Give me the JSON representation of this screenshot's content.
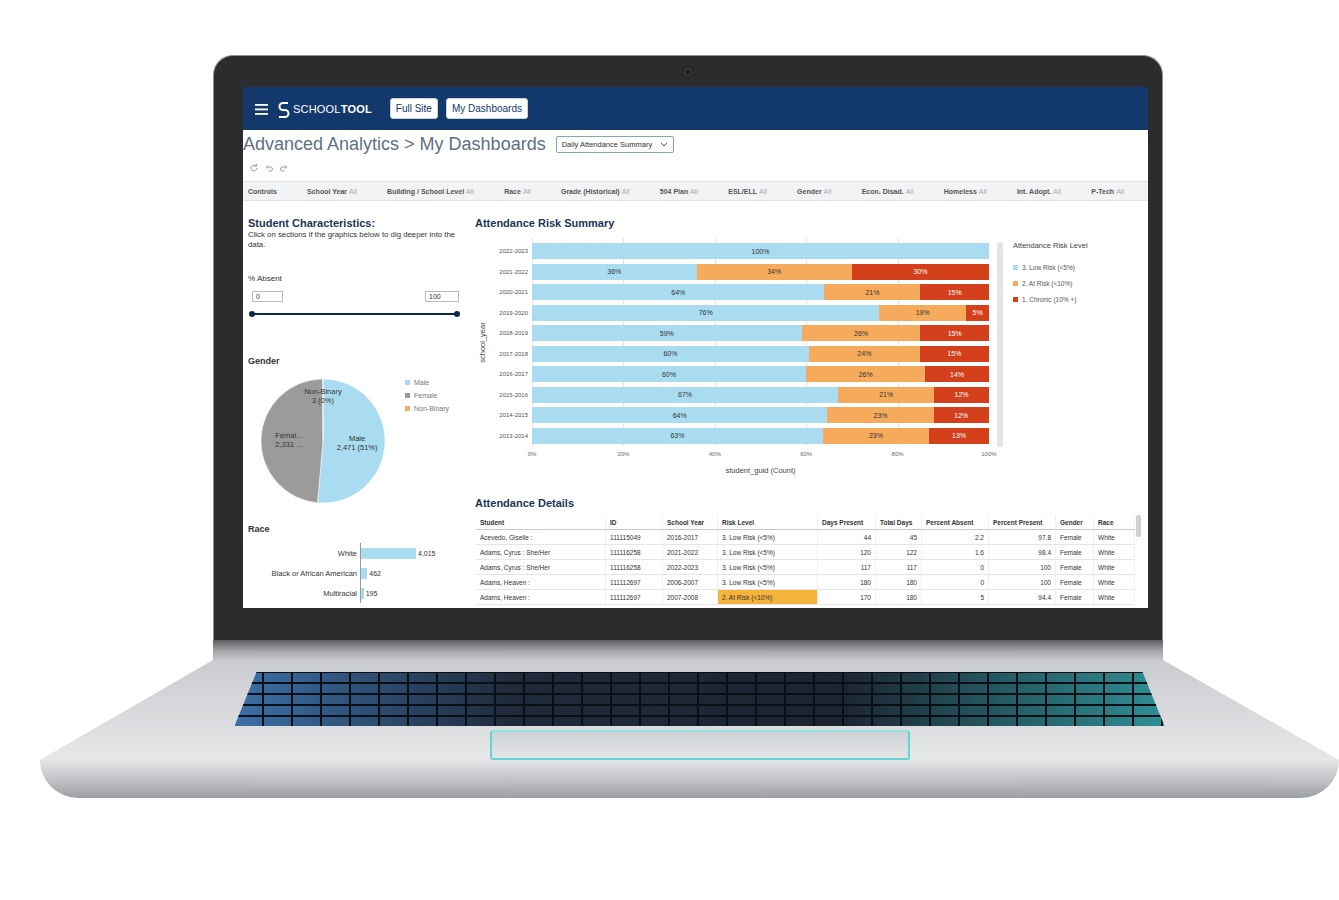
{
  "header": {
    "logo": {
      "light": "SCHOOL",
      "bold": "TOOL"
    },
    "buttons": [
      {
        "label": "Full Site"
      },
      {
        "label": "My Dashboards"
      }
    ]
  },
  "breadcrumb": "Advanced Analytics > My Dashboards",
  "dashboard_select": {
    "value": "Daily Attendance Summary"
  },
  "controls": {
    "label": "Controls",
    "filters": [
      {
        "label": "School Year",
        "value": "All"
      },
      {
        "label": "Building / School Level",
        "value": "All"
      },
      {
        "label": "Race",
        "value": "All"
      },
      {
        "label": "Grade (Historical)",
        "value": "All"
      },
      {
        "label": "504 Plan",
        "value": "All"
      },
      {
        "label": "ESL/ELL",
        "value": "All"
      },
      {
        "label": "Gender",
        "value": "All"
      },
      {
        "label": "Econ. Disad.",
        "value": "All"
      },
      {
        "label": "Homeless",
        "value": "All"
      },
      {
        "label": "Int. Adopt.",
        "value": "All"
      },
      {
        "label": "P-Tech",
        "value": "All"
      }
    ]
  },
  "characteristics": {
    "title": "Student Characteristics:",
    "hint": "Click on sections if the graphics below to dig deeper into the data.",
    "absent": {
      "label": "% Absent",
      "min": "0",
      "max": "100",
      "level": 1
    },
    "gender": {
      "title": "Gender",
      "slices": [
        {
          "label": "Male",
          "count": "2,471 (51%)",
          "value": 2471,
          "color": "#a9dcf0",
          "legend": "Male"
        },
        {
          "label": "Femal...",
          "count": "2,331 ...",
          "value": 2331,
          "color": "#9b9b9b",
          "legend": "Female"
        },
        {
          "label": "Non-Binary",
          "count": "3 (0%)",
          "value": 3,
          "color": "#f5aa5c",
          "legend": "Non-Binary"
        }
      ]
    },
    "race": {
      "title": "Race",
      "bars": [
        {
          "label": "White",
          "count": "4,015",
          "value": 4015
        },
        {
          "label": "Black or African American",
          "count": "462",
          "value": 462
        },
        {
          "label": "Multiracial",
          "count": "195",
          "value": 195
        }
      ]
    }
  },
  "risk_chart": {
    "title": "Attendance Risk Summary",
    "y_title": "school_year",
    "x_title": "student_guid (Count)",
    "ticks": [
      "0%",
      "20%",
      "40%",
      "60%",
      "80%",
      "100%"
    ],
    "legend_title": "Attendance Risk Level",
    "categories": [
      "2022-2023",
      "2021-2022",
      "2020-2021",
      "2019-2020",
      "2018-2019",
      "2017-2018",
      "2016-2017",
      "2015-2016",
      "2014-2015",
      "2013-2014"
    ],
    "series": [
      {
        "name": "3. Low Risk (<5%)",
        "color": "#a9dcf0",
        "values": [
          100,
          36,
          64,
          76,
          59,
          60,
          60,
          67,
          64,
          63
        ],
        "labels": [
          "100%",
          "36%",
          "64%",
          "76%",
          "59%",
          "60%",
          "60%",
          "67%",
          "64%",
          "63%"
        ]
      },
      {
        "name": "2. At Risk (<10%)",
        "color": "#f5aa5c",
        "values": [
          0,
          34,
          21,
          19,
          26,
          24,
          26,
          21,
          23,
          23
        ],
        "labels": [
          null,
          "34%",
          "21%",
          "19%",
          "26%",
          "24%",
          "26%",
          "21%",
          "23%",
          "23%"
        ]
      },
      {
        "name": "1. Chronic (10% +)",
        "color": "#d4401b",
        "values": [
          0,
          30,
          15,
          5,
          15,
          15,
          14,
          12,
          12,
          13
        ],
        "labels": [
          null,
          "30%",
          "15%",
          "5%",
          "15%",
          "15%",
          "14%",
          "12%",
          "12%",
          "13%"
        ]
      }
    ]
  },
  "details": {
    "title": "Attendance Details",
    "columns": [
      "Student",
      "ID",
      "School Year",
      "Risk Level",
      "Days Present",
      "Total Days",
      "Percent Absent",
      "Percent Present",
      "Gender",
      "Race"
    ],
    "rows": [
      {
        "cells": [
          "Acevedo, Giselle :",
          "111115049",
          "2016-2017",
          "3. Low Risk (<5%)",
          "44",
          "45",
          "2.2",
          "97.8",
          "Female",
          "White"
        ],
        "highlight": false
      },
      {
        "cells": [
          "Adams, Cyrus : She/Her",
          "111116258",
          "2021-2022",
          "3. Low Risk (<5%)",
          "120",
          "122",
          "1.6",
          "98.4",
          "Female",
          "White"
        ],
        "highlight": false
      },
      {
        "cells": [
          "Adams, Cyrus : She/Her",
          "111116258",
          "2022-2023",
          "3. Low Risk (<5%)",
          "117",
          "117",
          "0",
          "100",
          "Female",
          "White"
        ],
        "highlight": false
      },
      {
        "cells": [
          "Adams, Heaven :",
          "111112697",
          "2006-2007",
          "3. Low Risk (<5%)",
          "180",
          "180",
          "0",
          "100",
          "Female",
          "White"
        ],
        "highlight": false
      },
      {
        "cells": [
          "Adams, Heaven :",
          "111112697",
          "2007-2008",
          "2. At Risk (<10%)",
          "170",
          "180",
          "5",
          "94.4",
          "Female",
          "White"
        ],
        "highlight": true
      }
    ]
  }
}
